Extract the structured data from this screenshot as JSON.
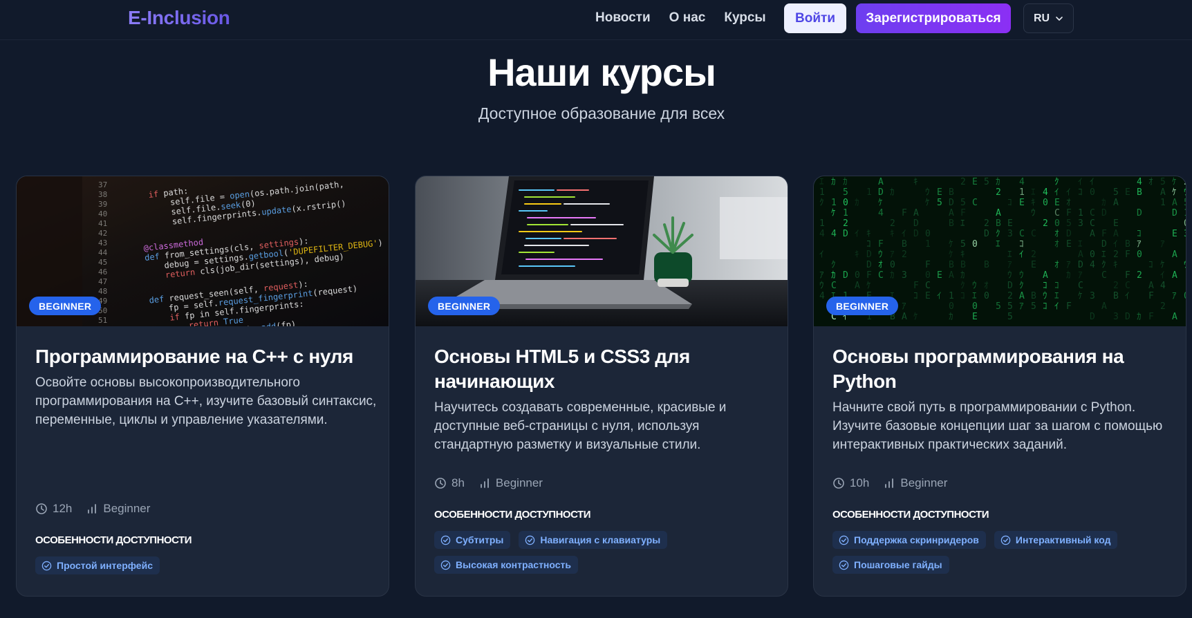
{
  "header": {
    "logo": "E-Inclusion",
    "nav": [
      "Новости",
      "О нас",
      "Курсы"
    ],
    "login_label": "Войти",
    "register_label": "Зарегистрироваться",
    "lang": "RU",
    "colors": {
      "accent": "#6d3ff0",
      "login_bg": "#eef0ff"
    }
  },
  "hero": {
    "title": "Наши курсы",
    "subtitle": "Доступное образование для всех"
  },
  "features_heading": "ОСОБЕННОСТИ ДОСТУПНОСТИ",
  "courses": [
    {
      "badge": "BEGINNER",
      "image_icon": "code-editor-image",
      "title": "Программирование на С++ с нуля",
      "description": "Освойте основы высокопроизводительного программирования на C++, изучите базовый синтаксис, переменные, циклы и управление указателями.",
      "duration": "12h",
      "level": "Beginner",
      "features": [
        "Простой интерфейс"
      ]
    },
    {
      "badge": "BEGINNER",
      "image_icon": "laptop-image",
      "title": "Основы HTML5 и CSS3 для начинающих",
      "description": "Научитесь создавать современные, красивые и доступные веб-страницы с нуля, используя стандартную разметку и визуальные стили.",
      "duration": "8h",
      "level": "Beginner",
      "features": [
        "Субтитры",
        "Навигация с клавиатуры",
        "Высокая контрастность"
      ]
    },
    {
      "badge": "BEGINNER",
      "image_icon": "matrix-code-image",
      "title": "Основы программирования на Python",
      "description": "Начните свой путь в программировании с Python. Изучите базовые концепции шаг за шагом с помощью интерактивных практических заданий.",
      "duration": "10h",
      "level": "Beginner",
      "features": [
        "Поддержка скринридеров",
        "Интерактивный код",
        "Пошаговые гайды"
      ]
    }
  ]
}
